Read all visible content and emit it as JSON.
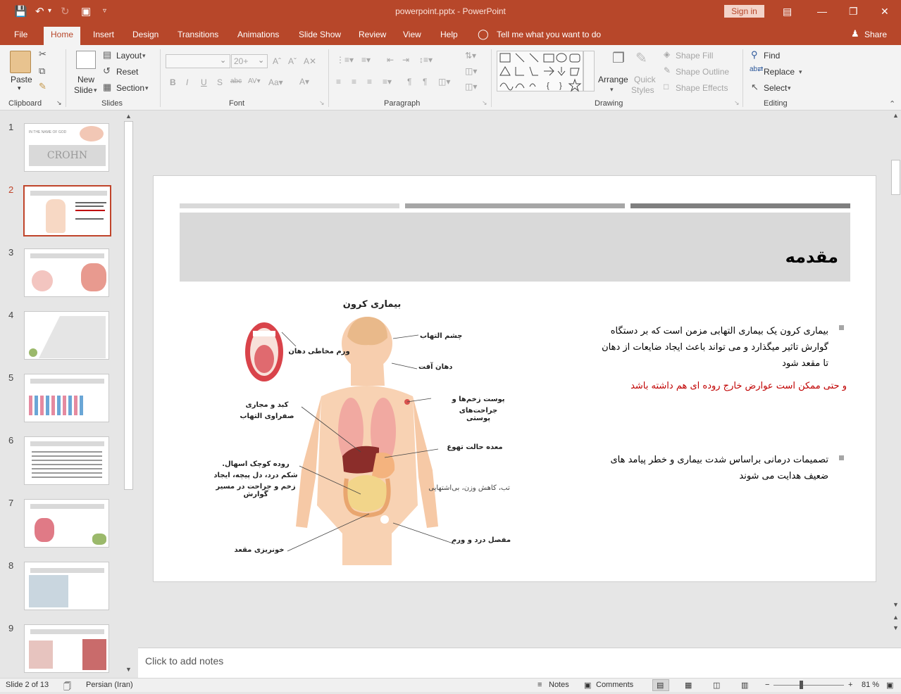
{
  "titlebar": {
    "doc_title": "powerpoint.pptx  -  PowerPoint",
    "sign_in": "Sign in"
  },
  "tabs": [
    {
      "label": "File"
    },
    {
      "label": "Home"
    },
    {
      "label": "Insert"
    },
    {
      "label": "Design"
    },
    {
      "label": "Transitions"
    },
    {
      "label": "Animations"
    },
    {
      "label": "Slide Show"
    },
    {
      "label": "Review"
    },
    {
      "label": "View"
    },
    {
      "label": "Help"
    }
  ],
  "tell_me": "Tell me what you want to do",
  "share": "Share",
  "ribbon": {
    "clipboard": {
      "paste": "Paste",
      "label": "Clipboard"
    },
    "slides": {
      "new_slide_1": "New",
      "new_slide_2": "Slide",
      "layout": "Layout",
      "reset": "Reset",
      "section": "Section",
      "label": "Slides"
    },
    "font": {
      "size": "20+",
      "label": "Font"
    },
    "paragraph": {
      "label": "Paragraph"
    },
    "drawing": {
      "arrange": "Arrange",
      "quick_styles_1": "Quick",
      "quick_styles_2": "Styles",
      "shape_fill": "Shape Fill",
      "shape_outline": "Shape Outline",
      "shape_effects": "Shape Effects",
      "label": "Drawing"
    },
    "editing": {
      "find": "Find",
      "replace": "Replace",
      "select": "Select",
      "label": "Editing"
    }
  },
  "thumbnails": [
    {
      "num": "1",
      "title": "CROHN",
      "subtitle": "IN THE NAME OF GOD"
    },
    {
      "num": "2"
    },
    {
      "num": "3"
    },
    {
      "num": "4"
    },
    {
      "num": "5"
    },
    {
      "num": "6"
    },
    {
      "num": "7"
    },
    {
      "num": "8"
    },
    {
      "num": "9"
    }
  ],
  "slide": {
    "title": "مقدمه",
    "diagram_title": "بیماری کرون",
    "labels": {
      "mouth_inflam": "ورم مخاطی دهان",
      "eye": "چشم التهاب",
      "mouth_ulcer": "دهان آفت",
      "skin_1": "پوست زخم‌ها و",
      "skin_2": "جراحت‌های پوستی",
      "liver_1": "کبد و مجاری",
      "liver_2": "صفراوی التهاب",
      "stomach": "معده حالت تهوع",
      "intestine_1": "روده کوچک اسهال.",
      "intestine_2": "شکم درد، دل پیچه، ایجاد",
      "intestine_3": "زخم و جراحت در مسیر گوارش",
      "fever": "تب، کاهش وزن، بی‌اشتهایی",
      "joint": "مفصل درد و ورم",
      "rectum": "خونریزی مقعد"
    },
    "bullet1_l1": "بیماری کرون یک بیماری التهابی مزمن است که بر دستگاه",
    "bullet1_l2": "گوارش تاثیر میگذارد و می تواند باعث ایجاد ضایعات از دهان",
    "bullet1_l3": "تا مقعد شود",
    "red_line": "و حتی ممکن است عوارض خارج روده ای هم داشته باشد",
    "bullet2_l1": "تصمیمات درمانی براساس شدت بیماری و خطر پیامد های",
    "bullet2_l2": "ضعیف هدایت می شوند"
  },
  "notes_placeholder": "Click to add notes",
  "status": {
    "slide": "Slide 2 of 13",
    "language": "Persian (Iran)",
    "notes": "Notes",
    "comments": "Comments",
    "zoom": "81 %"
  },
  "colors": {
    "accent": "#b7472a",
    "red_text": "#c00000"
  }
}
